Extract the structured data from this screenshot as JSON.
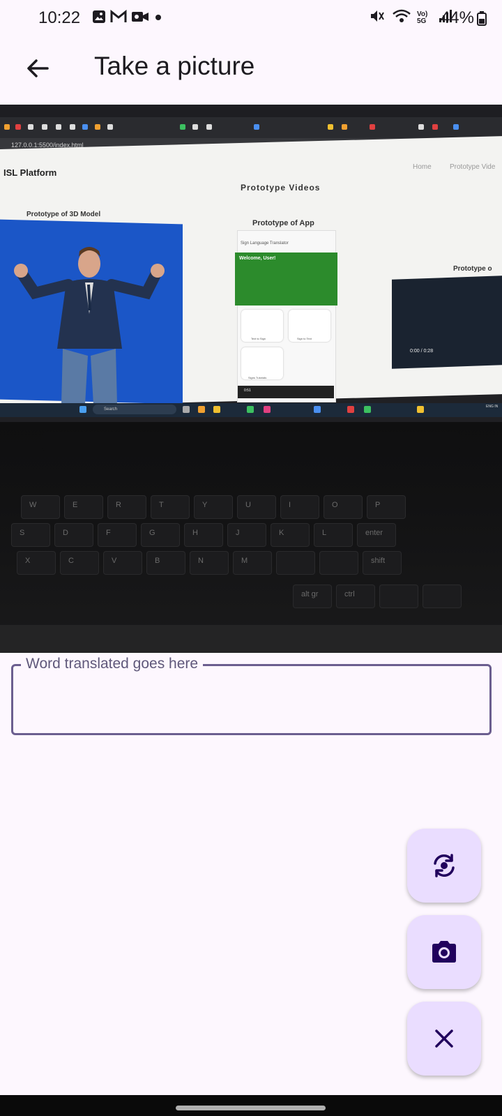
{
  "status_bar": {
    "time": "10:22",
    "network_label": "Vo) 5G",
    "battery": "44%",
    "left_icons": [
      "gallery-icon",
      "gmail-icon",
      "video-record-icon",
      "dot-icon"
    ],
    "right_icons": [
      "mute-icon",
      "wifi-icon",
      "volte-5g-icon",
      "signal-icon",
      "battery-icon"
    ]
  },
  "app_bar": {
    "title": "Take a picture",
    "back_icon": "arrow-left-icon"
  },
  "camera_preview": {
    "url": "127.0.0.1:5500/index.html",
    "site_title": "ISL Platform",
    "nav_home": "Home",
    "nav_prototype": "Prototype Vide",
    "section_heading": "Prototype Videos",
    "label_3d_model": "Prototype of 3D Model",
    "label_app": "Prototype of App",
    "label_third": "Prototype o",
    "phone_app_title": "Sign Language Translator",
    "phone_welcome": "Welcome, User!",
    "phone_tile_1": "Text to Sign",
    "phone_tile_2": "Sign to Text",
    "phone_tile_3": "Signs Tutorials",
    "phone_video_time": "0:51",
    "video_time": "0:00 / 0:28",
    "taskbar_search": "Search",
    "tray_lang": "ENG IN",
    "keyboard_row1": [
      "W",
      "E",
      "R",
      "T",
      "Y",
      "U",
      "I",
      "O",
      "P"
    ],
    "keyboard_row2": [
      "S",
      "D",
      "F",
      "G",
      "H",
      "J",
      "K",
      "L"
    ],
    "keyboard_row3": [
      "X",
      "C",
      "V",
      "B",
      "N",
      "M"
    ],
    "keyboard_extra": [
      "alt gr",
      "ctrl",
      "enter",
      "shift"
    ]
  },
  "word_field": {
    "label": "Word translated goes here",
    "value": ""
  },
  "fabs": {
    "switch_camera_icon": "switch-camera-icon",
    "camera_icon": "camera-icon",
    "close_icon": "close-icon"
  },
  "colors": {
    "background": "#fdf7fe",
    "fab_background": "#eaddff",
    "fab_icon": "#21005d",
    "field_border": "#6b5e8f",
    "label_text": "#5f587a"
  }
}
